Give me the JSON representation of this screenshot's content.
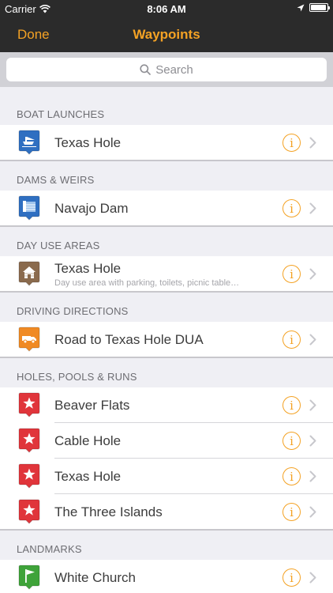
{
  "status": {
    "carrier": "Carrier",
    "time": "8:06 AM",
    "battery_level": 0.95
  },
  "nav": {
    "done": "Done",
    "title": "Waypoints"
  },
  "search": {
    "placeholder": "Search"
  },
  "sections": [
    {
      "header": "BOAT LAUNCHES",
      "items": [
        {
          "name": "Texas Hole",
          "icon": "boat-launch-icon"
        }
      ]
    },
    {
      "header": "DAMS & WEIRS",
      "items": [
        {
          "name": "Navajo Dam",
          "icon": "dam-icon"
        }
      ]
    },
    {
      "header": "DAY USE AREAS",
      "items": [
        {
          "name": "Texas Hole",
          "sub": "Day use area with parking, toilets, picnic table…",
          "icon": "cabin-icon"
        }
      ]
    },
    {
      "header": "DRIVING DIRECTIONS",
      "items": [
        {
          "name": "Road to Texas Hole DUA",
          "icon": "truck-icon"
        }
      ]
    },
    {
      "header": "HOLES, POOLS & RUNS",
      "items": [
        {
          "name": "Beaver Flats",
          "icon": "star-icon"
        },
        {
          "name": "Cable Hole",
          "icon": "star-icon"
        },
        {
          "name": "Texas Hole",
          "icon": "star-icon"
        },
        {
          "name": "The Three Islands",
          "icon": "star-icon"
        }
      ]
    },
    {
      "header": "LANDMARKS",
      "items": [
        {
          "name": "White Church",
          "icon": "flag-icon"
        }
      ]
    }
  ],
  "colors": {
    "accent": "#f4a224",
    "boat-launch-icon": "#2f6fc1",
    "dam-icon": "#2f6fc1",
    "cabin-icon": "#8a6a4d",
    "truck-icon": "#f08a24",
    "star-icon": "#e0353b",
    "flag-icon": "#3fa33a"
  }
}
